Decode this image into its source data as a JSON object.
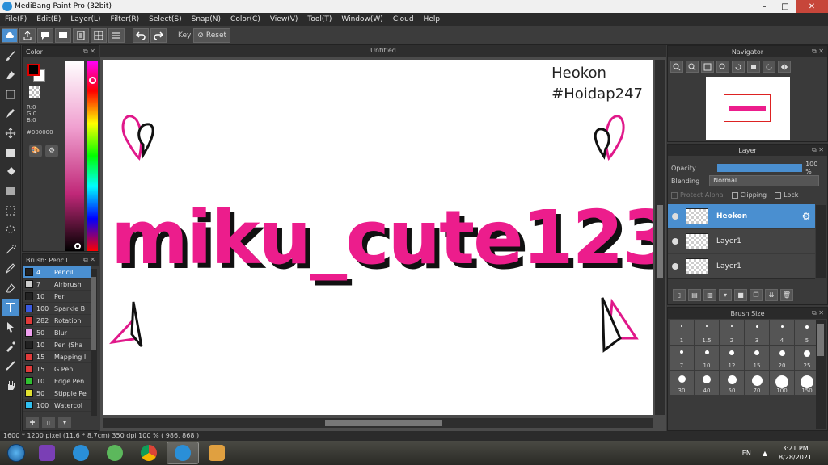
{
  "window": {
    "title": "MediBang Paint Pro (32bit)",
    "minimize": "–",
    "maximize": "□",
    "close": "✕"
  },
  "menu": [
    "File(F)",
    "Edit(E)",
    "Layer(L)",
    "Filter(R)",
    "Select(S)",
    "Snap(N)",
    "Color(C)",
    "View(V)",
    "Tool(T)",
    "Window(W)",
    "Cloud",
    "Help"
  ],
  "toolbar": {
    "key_label": "Key",
    "reset_label": "Reset"
  },
  "color_panel": {
    "title": "Color",
    "r": "R:0",
    "g": "G:0",
    "b": "B:0",
    "hex": "#000000",
    "fg": "#000000",
    "bg": "#ffffff"
  },
  "brush_panel": {
    "title": "Brush: Pencil",
    "brushes": [
      {
        "size": "4",
        "name": "Pencil",
        "color": "#222222",
        "selected": true
      },
      {
        "size": "7",
        "name": "Airbrush",
        "color": "#cccccc"
      },
      {
        "size": "10",
        "name": "Pen",
        "color": "#222222"
      },
      {
        "size": "100",
        "name": "Sparkle B",
        "color": "#3a5ae0"
      },
      {
        "size": "282",
        "name": "Rotation",
        "color": "#e03a3a"
      },
      {
        "size": "50",
        "name": "Blur",
        "color": "#f0a0f0"
      },
      {
        "size": "10",
        "name": "Pen (Sha",
        "color": "#222222"
      },
      {
        "size": "15",
        "name": "Mapping I",
        "color": "#e03a3a"
      },
      {
        "size": "15",
        "name": "G Pen",
        "color": "#e03a3a"
      },
      {
        "size": "10",
        "name": "Edge Pen",
        "color": "#30c030"
      },
      {
        "size": "50",
        "name": "Stipple Pe",
        "color": "#e0e030"
      },
      {
        "size": "100",
        "name": "Watercol",
        "color": "#30c0f0"
      }
    ]
  },
  "document": {
    "tab": "Untitled",
    "artwork_text": "miku_cute123",
    "signature_line1": "Heokon",
    "signature_line2": "#Hoidap247"
  },
  "navigator": {
    "title": "Navigator"
  },
  "layer_panel": {
    "title": "Layer",
    "opacity_label": "Opacity",
    "opacity_value": "100 %",
    "opacity": 1.0,
    "blending_label": "Blending",
    "blending_value": "Normal",
    "protect_alpha": "Protect Alpha",
    "clipping": "Clipping",
    "lock": "Lock",
    "layers": [
      {
        "name": "Heokon",
        "selected": true
      },
      {
        "name": "Layer1"
      },
      {
        "name": "Layer1"
      }
    ]
  },
  "brush_size_panel": {
    "title": "Brush Size",
    "sizes": [
      "1",
      "1.5",
      "2",
      "3",
      "4",
      "5",
      "7",
      "10",
      "12",
      "15",
      "20",
      "25",
      "30",
      "40",
      "50",
      "70",
      "100",
      "150"
    ]
  },
  "status": "1600 * 1200 pixel   (11.6 * 8.7cm)   350 dpi   100 %   ( 986, 868 )",
  "taskbar": {
    "lang": "EN",
    "time": "3:21 PM",
    "date": "8/28/2021"
  }
}
